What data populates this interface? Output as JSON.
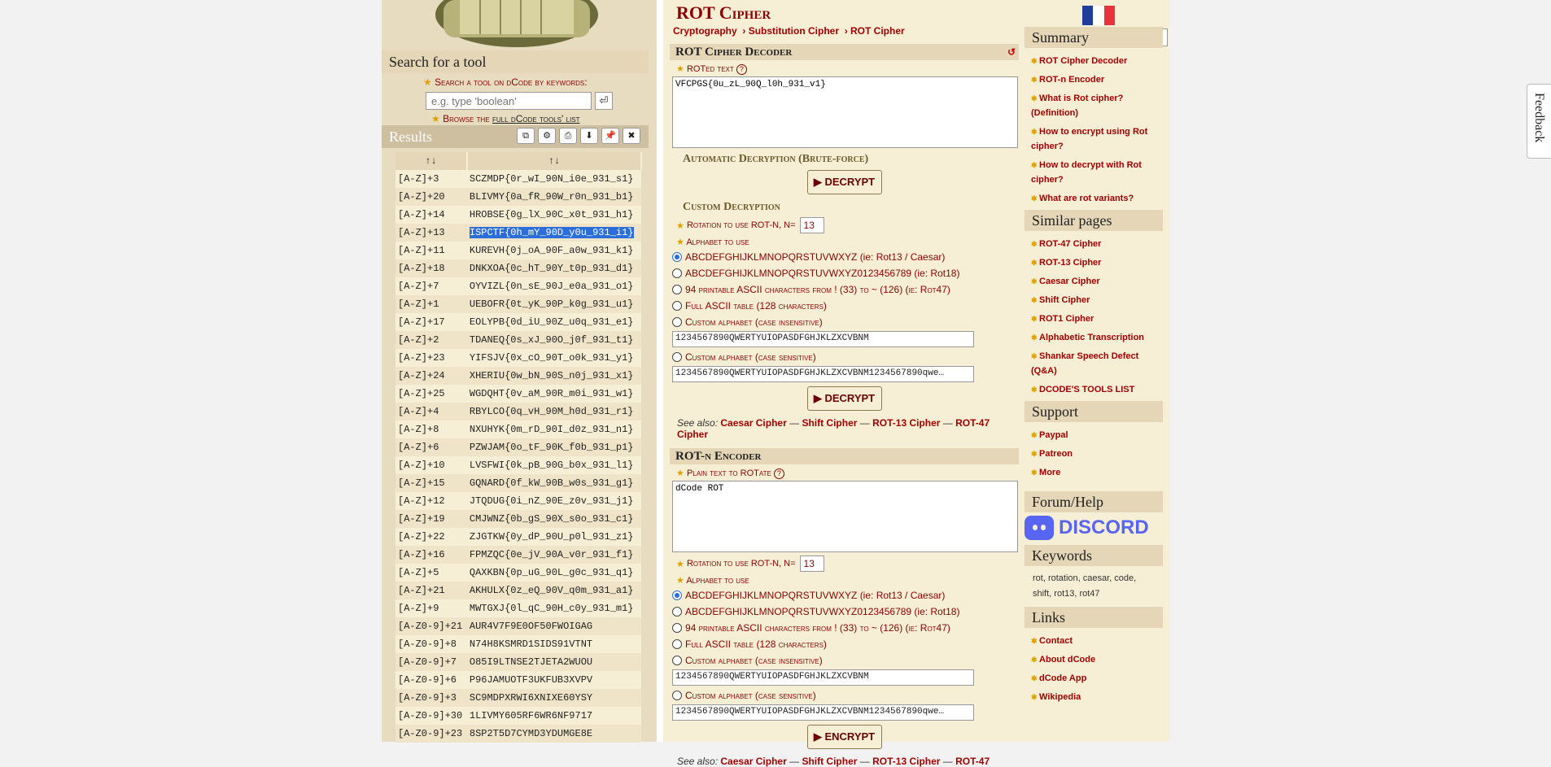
{
  "search": {
    "title": "Search for a tool",
    "label": "Search a tool on dCode by keywords:",
    "placeholder": "e.g. type 'boolean'",
    "go_icon": "⏎",
    "browse_prefix": "Browse the",
    "browse_link": "full dCode tools' list"
  },
  "results": {
    "title": "Results",
    "header_col1": "↑↓",
    "header_col2": "↑↓",
    "rows": [
      {
        "key": "[A-Z]+3",
        "val": "SCZMDP{0r_wI_90N_i0e_931_s1}"
      },
      {
        "key": "[A-Z]+20",
        "val": "BLIVMY{0a_fR_90W_r0n_931_b1}"
      },
      {
        "key": "[A-Z]+14",
        "val": "HROBSE{0g_lX_90C_x0t_931_h1}"
      },
      {
        "key": "[A-Z]+13",
        "val": "ISPCTF{0h_mY_90D_y0u_931_i1}"
      },
      {
        "key": "[A-Z]+11",
        "val": "KUREVH{0j_oA_90F_a0w_931_k1}"
      },
      {
        "key": "[A-Z]+18",
        "val": "DNKXOA{0c_hT_90Y_t0p_931_d1}"
      },
      {
        "key": "[A-Z]+7",
        "val": "OYVIZL{0n_sE_90J_e0a_931_o1}"
      },
      {
        "key": "[A-Z]+1",
        "val": "UEBOFR{0t_yK_90P_k0g_931_u1}"
      },
      {
        "key": "[A-Z]+17",
        "val": "EOLYPB{0d_iU_90Z_u0q_931_e1}"
      },
      {
        "key": "[A-Z]+2",
        "val": "TDANEQ{0s_xJ_90O_j0f_931_t1}"
      },
      {
        "key": "[A-Z]+23",
        "val": "YIFSJV{0x_cO_90T_o0k_931_y1}"
      },
      {
        "key": "[A-Z]+24",
        "val": "XHERIU{0w_bN_90S_n0j_931_x1}"
      },
      {
        "key": "[A-Z]+25",
        "val": "WGDQHT{0v_aM_90R_m0i_931_w1}"
      },
      {
        "key": "[A-Z]+4",
        "val": "RBYLCO{0q_vH_90M_h0d_931_r1}"
      },
      {
        "key": "[A-Z]+8",
        "val": "NXUHYK{0m_rD_90I_d0z_931_n1}"
      },
      {
        "key": "[A-Z]+6",
        "val": "PZWJAM{0o_tF_90K_f0b_931_p1}"
      },
      {
        "key": "[A-Z]+10",
        "val": "LVSFWI{0k_pB_90G_b0x_931_l1}"
      },
      {
        "key": "[A-Z]+15",
        "val": "GQNARD{0f_kW_90B_w0s_931_g1}"
      },
      {
        "key": "[A-Z]+12",
        "val": "JTQDUG{0i_nZ_90E_z0v_931_j1}"
      },
      {
        "key": "[A-Z]+19",
        "val": "CMJWNZ{0b_gS_90X_s0o_931_c1}"
      },
      {
        "key": "[A-Z]+22",
        "val": "ZJGTKW{0y_dP_90U_p0l_931_z1}"
      },
      {
        "key": "[A-Z]+16",
        "val": "FPMZQC{0e_jV_90A_v0r_931_f1}"
      },
      {
        "key": "[A-Z]+5",
        "val": "QAXKBN{0p_uG_90L_g0c_931_q1}"
      },
      {
        "key": "[A-Z]+21",
        "val": "AKHULX{0z_eQ_90V_q0m_931_a1}"
      },
      {
        "key": "[A-Z]+9",
        "val": "MWTGXJ{0l_qC_90H_c0y_931_m1}"
      },
      {
        "key": "[A-Z0-9]+21",
        "val": "AUR4V7F9E0OF50FWOIGAG"
      },
      {
        "key": "[A-Z0-9]+8",
        "val": "N74H8KSMRD1SIDS91VTNT"
      },
      {
        "key": "[A-Z0-9]+7",
        "val": "O85I9LTNSE2TJETA2WUOU"
      },
      {
        "key": "[A-Z0-9]+6",
        "val": "P96JAMUOTF3UKFUB3XVPV"
      },
      {
        "key": "[A-Z0-9]+3",
        "val": "SC9MDPXRWI6XNIXE60YSY"
      },
      {
        "key": "[A-Z0-9]+30",
        "val": "1LIVMY605RF6WR6NF9717"
      },
      {
        "key": "[A-Z0-9]+23",
        "val": "8SP2T5D7CYMD3YDUMGE8E"
      }
    ],
    "highlighted_index": 3
  },
  "header": {
    "title": "ROT Cipher",
    "crumbs": [
      "Cryptography",
      "› Substitution Cipher",
      "› ROT Cipher"
    ]
  },
  "decoder": {
    "title": "ROT Cipher Decoder",
    "text_label": "ROTed text",
    "text_value": "VFCPGS{0u_zL_90Q_l0h_931_v1}",
    "auto_title": "Automatic Decryption (Brute-force)",
    "decrypt_label": "▶ DECRYPT",
    "custom_title": "Custom Decryption",
    "rot_label": "Rotation to use ROT-N, N=",
    "rot_value": "13",
    "alphabet_label": "Alphabet to use",
    "options": [
      "ABCDEFGHIJKLMNOPQRSTUVWXYZ (ie: Rot13 / Caesar)",
      "ABCDEFGHIJKLMNOPQRSTUVWXYZ0123456789 (ie: Rot18)",
      "94 printable ASCII characters from ! (33) to ~ (126) (ie: Rot47)",
      "Full ASCII table (128 characters)",
      "Custom alphabet (case insensitive)",
      "Custom alphabet (case sensitive)"
    ],
    "custom_ci_value": "1234567890QWERTYUIOPASDFGHJKLZXCVBNM",
    "custom_cs_value": "1234567890QWERTYUIOPASDFGHJKLZXCVBNM1234567890qwe…",
    "see_also_label": "See also:",
    "see_also": [
      "Caesar Cipher",
      "Shift Cipher",
      "ROT-13 Cipher",
      "ROT-47 Cipher"
    ]
  },
  "encoder": {
    "title": "ROT-n Encoder",
    "text_label": "Plain text to ROTate",
    "text_value": "dCode ROT",
    "rot_label": "Rotation to use ROT-N, N=",
    "rot_value": "13",
    "alphabet_label": "Alphabet to use",
    "options": [
      "ABCDEFGHIJKLMNOPQRSTUVWXYZ (ie: Rot13 / Caesar)",
      "ABCDEFGHIJKLMNOPQRSTUVWXYZ0123456789 (ie: Rot18)",
      "94 printable ASCII characters from ! (33) to ~ (126) (ie: Rot47)",
      "Full ASCII table (128 characters)",
      "Custom alphabet (case insensitive)",
      "Custom alphabet (case sensitive)"
    ],
    "custom_ci_value": "1234567890QWERTYUIOPASDFGHJKLZXCVBNM",
    "custom_cs_value": "1234567890QWERTYUIOPASDFGHJKLZXCVBNM1234567890qwe…",
    "encrypt_label": "▶ ENCRYPT",
    "see_also_label": "See also:",
    "see_also": [
      "Caesar Cipher",
      "Shift Cipher",
      "ROT-13 Cipher",
      "ROT-47"
    ]
  },
  "sidebar": {
    "summary_title": "Summary",
    "summary": [
      "ROT Cipher Decoder",
      "ROT-n Encoder",
      "What is Rot cipher? (Definition)",
      "How to encrypt using Rot cipher?",
      "How to decrypt with Rot cipher?",
      "What are rot variants?"
    ],
    "similar_title": "Similar pages",
    "similar": [
      "ROT-47 Cipher",
      "ROT-13 Cipher",
      "Caesar Cipher",
      "Shift Cipher",
      "ROT1 Cipher",
      "Alphabetic Transcription",
      "Shankar Speech Defect (Q&A)",
      "DCODE'S TOOLS LIST"
    ],
    "support_title": "Support",
    "support": [
      "Paypal",
      "Patreon",
      "More"
    ],
    "forum_title": "Forum/Help",
    "discord_label": "DISCORD",
    "keywords_title": "Keywords",
    "keywords": "rot, rotation, caesar, code, shift, rot13, rot47",
    "links_title": "Links",
    "links": [
      "Contact",
      "About dCode",
      "dCode App",
      "Wikipedia"
    ]
  },
  "feedback_label": "Feedback",
  "colors": {
    "accent": "#8a0000",
    "link": "#a00000",
    "highlight": "#2b6ed9",
    "paper": "#f7eed6"
  }
}
